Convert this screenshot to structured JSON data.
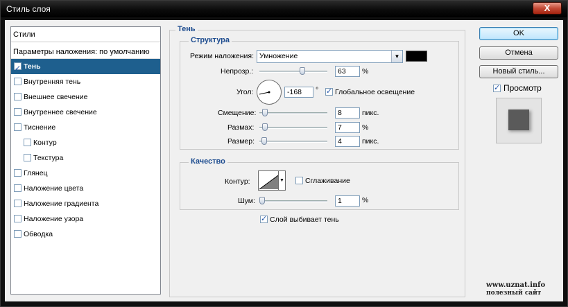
{
  "window": {
    "title": "Стиль слоя",
    "close_label": "X"
  },
  "styles_panel": {
    "header": "Стили",
    "blend_defaults": "Параметры наложения: по умолчанию",
    "items": [
      {
        "label": "Тень",
        "checked": true,
        "selected": true,
        "indent": false
      },
      {
        "label": "Внутренняя тень",
        "checked": false,
        "selected": false,
        "indent": false
      },
      {
        "label": "Внешнее свечение",
        "checked": false,
        "selected": false,
        "indent": false
      },
      {
        "label": "Внутреннее свечение",
        "checked": false,
        "selected": false,
        "indent": false
      },
      {
        "label": "Тиснение",
        "checked": false,
        "selected": false,
        "indent": false
      },
      {
        "label": "Контур",
        "checked": false,
        "selected": false,
        "indent": true
      },
      {
        "label": "Текстура",
        "checked": false,
        "selected": false,
        "indent": true
      },
      {
        "label": "Глянец",
        "checked": false,
        "selected": false,
        "indent": false
      },
      {
        "label": "Наложение цвета",
        "checked": false,
        "selected": false,
        "indent": false
      },
      {
        "label": "Наложение градиента",
        "checked": false,
        "selected": false,
        "indent": false
      },
      {
        "label": "Наложение узора",
        "checked": false,
        "selected": false,
        "indent": false
      },
      {
        "label": "Обводка",
        "checked": false,
        "selected": false,
        "indent": false
      }
    ]
  },
  "shadow": {
    "section_title": "Тень",
    "structure": {
      "title": "Структура",
      "blend_mode_label": "Режим наложения:",
      "blend_mode_value": "Умножение",
      "shadow_color": "#000000",
      "opacity_label": "Непрозр.:",
      "opacity_value": "63",
      "opacity_unit": "%",
      "opacity_level": 0.63,
      "angle_label": "Угол:",
      "angle_value": "-168",
      "angle_unit": "°",
      "global_light_label": "Глобальное освещение",
      "global_light_checked": true,
      "distance_label": "Смещение:",
      "distance_value": "8",
      "distance_unit": "пикс.",
      "spread_label": "Размах:",
      "spread_value": "7",
      "spread_unit": "%",
      "size_label": "Размер:",
      "size_value": "4",
      "size_unit": "пикс."
    },
    "quality": {
      "title": "Качество",
      "contour_label": "Контур:",
      "antialias_label": "Сглаживание",
      "antialias_checked": false,
      "noise_label": "Шум:",
      "noise_value": "1",
      "noise_unit": "%"
    },
    "knockout_label": "Слой выбивает тень",
    "knockout_checked": true
  },
  "buttons": {
    "ok": "OK",
    "cancel": "Отмена",
    "new_style": "Новый стиль...",
    "preview_label": "Просмотр",
    "preview_checked": true
  },
  "watermark": {
    "line1": "www.uznat.info",
    "line2": "полезный сайт"
  }
}
